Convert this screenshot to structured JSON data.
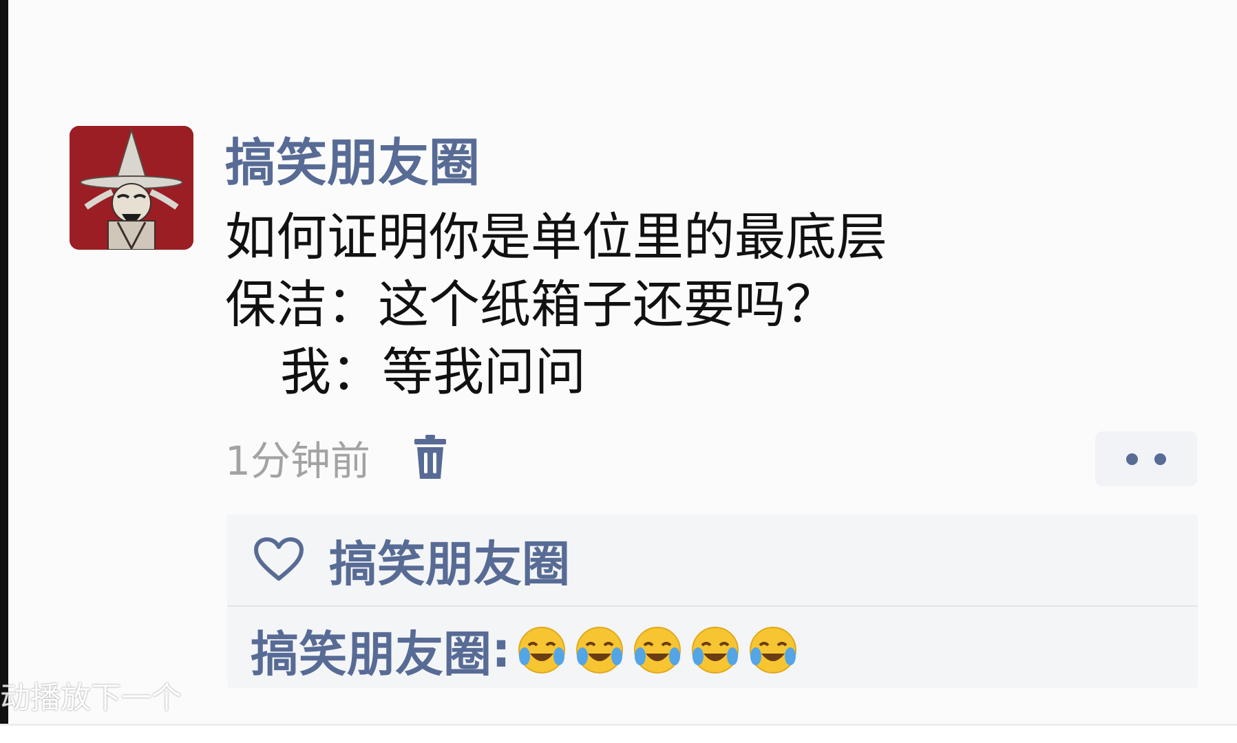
{
  "post": {
    "author": "搞笑朋友圈",
    "text_lines": [
      "如何证明你是单位里的最底层",
      "保洁：这个纸箱子还要吗？",
      "我：等我问问"
    ],
    "timestamp": "1分钟前"
  },
  "icons": {
    "delete": "trash-icon",
    "more": "more-dots-icon",
    "like": "heart-icon",
    "emoji": "laughing-crying-emoji"
  },
  "likes": {
    "names": [
      "搞笑朋友圈"
    ]
  },
  "comments": [
    {
      "author": "搞笑朋友圈",
      "separator": ":",
      "emoji_count": 5
    }
  ],
  "overlay": {
    "text": "动播放下一个"
  },
  "colors": {
    "link": "#576b95",
    "text": "#111111",
    "muted": "#a3a3a3",
    "panel": "#f4f5f7",
    "avatar_bg": "#8f1820"
  }
}
